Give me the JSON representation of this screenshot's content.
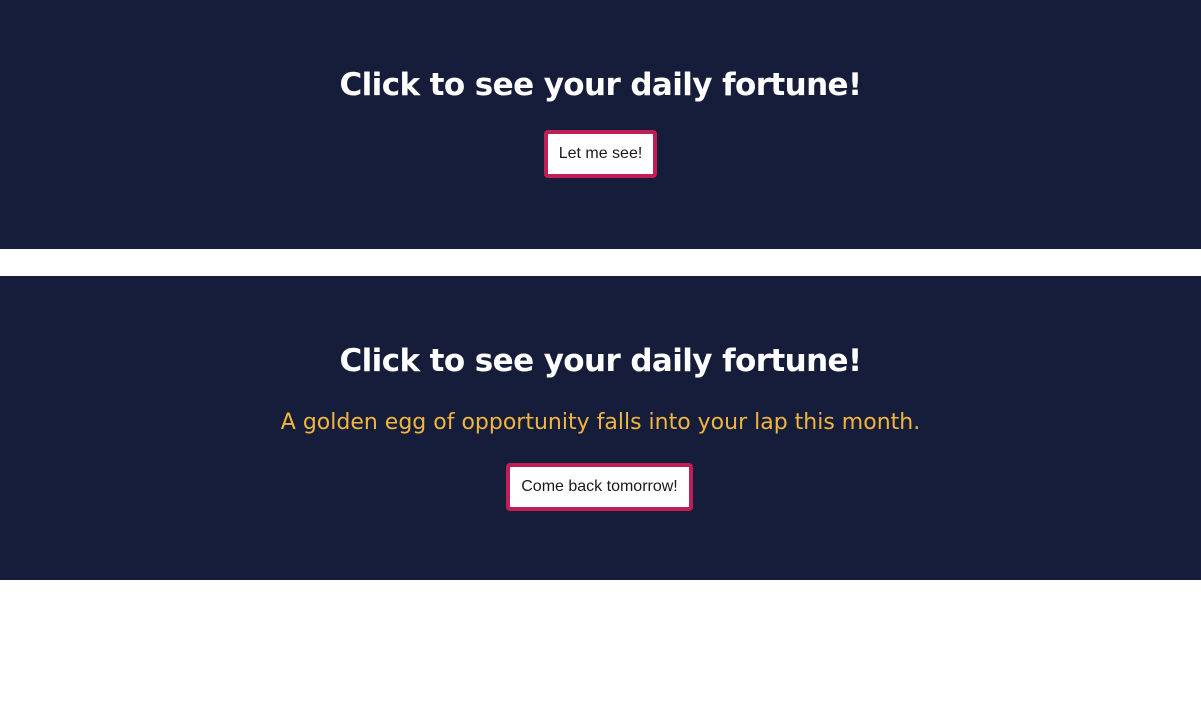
{
  "panel_1": {
    "title": "Click to see your daily fortune!",
    "button_label": "Let me see!"
  },
  "panel_2": {
    "title": "Click to see your daily fortune!",
    "fortune_text": "A golden egg of opportunity falls into your lap this month.",
    "button_label": "Come back tomorrow!"
  },
  "colors": {
    "panel_background": "#161d3b",
    "title_text": "#ffffff",
    "fortune_text": "#f2b53c",
    "button_border": "#c21e56",
    "page_background": "#ffffff"
  }
}
